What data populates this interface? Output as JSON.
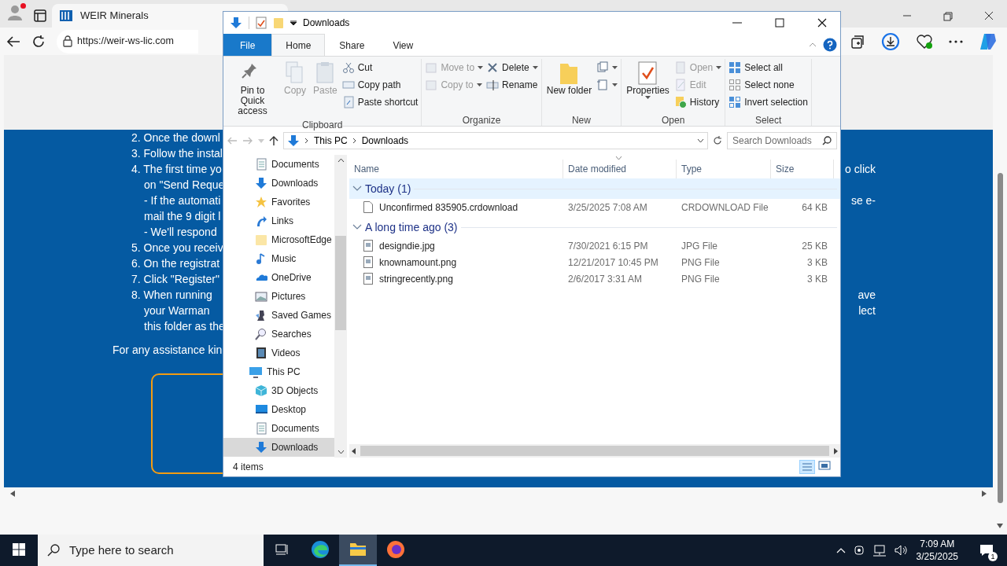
{
  "browser": {
    "tabs": [
      {
        "title": "WEIR Minerals",
        "selected": true
      }
    ],
    "address": "https://weir-ws-lic.com",
    "page": {
      "lines": [
        {
          "kind": "item",
          "text": "2. Once the downl"
        },
        {
          "kind": "item",
          "text": "3. Follow the instal"
        },
        {
          "kind": "item",
          "text": "4. The first time yo",
          "tail": "o click"
        },
        {
          "kind": "continuation",
          "text": "on \"Send Reque"
        },
        {
          "kind": "continuation",
          "text": "- If the automati",
          "tail": "se e-"
        },
        {
          "kind": "continuation",
          "text": "mail the 9 digit l"
        },
        {
          "kind": "continuation",
          "text": "- We'll respond"
        },
        {
          "kind": "item",
          "text": "5. Once you receiv"
        },
        {
          "kind": "item",
          "text": "6. On the registrat"
        },
        {
          "kind": "item",
          "text": "7. Click \"Register\""
        },
        {
          "kind": "item",
          "text": "8. When running",
          "tail": "ave"
        },
        {
          "kind": "continuation",
          "text": "your Warman",
          "tail": "lect"
        },
        {
          "kind": "continuation",
          "text": "this folder as the"
        },
        {
          "kind": "note",
          "text": "For any assistance kin"
        }
      ]
    }
  },
  "explorer": {
    "title": "Downloads",
    "ribbon_tabs": [
      {
        "label": "File",
        "kind": "file",
        "selected": false
      },
      {
        "label": "Home",
        "kind": "tab",
        "selected": true
      },
      {
        "label": "Share",
        "kind": "tab",
        "selected": false
      },
      {
        "label": "View",
        "kind": "tab",
        "selected": false
      }
    ],
    "ribbon_groups": [
      {
        "label": "Clipboard",
        "columns": [
          [
            {
              "kind": "pin",
              "label": "Pin to Quick access",
              "disabled": false
            }
          ],
          [
            {
              "kind": "copy",
              "label": "Copy",
              "disabled": true
            }
          ],
          [
            {
              "kind": "paste",
              "label": "Paste",
              "disabled": true
            }
          ],
          [
            {
              "kind": "cut",
              "label": "Cut",
              "disabled": false
            },
            {
              "kind": "path",
              "label": "Copy path",
              "disabled": false
            },
            {
              "kind": "shortcut",
              "label": "Paste shortcut",
              "disabled": false
            }
          ]
        ]
      },
      {
        "label": "Organize",
        "columns": [
          [
            {
              "kind": "move",
              "label": "Move to",
              "disabled": true
            },
            {
              "kind": "copyto",
              "label": "Copy to",
              "disabled": true
            }
          ],
          [
            {
              "kind": "delete",
              "label": "Delete",
              "disabled": false
            },
            {
              "kind": "rename",
              "label": "Rename",
              "disabled": false
            }
          ]
        ]
      },
      {
        "label": "New",
        "columns": [
          [
            {
              "kind": "folder",
              "label": "New folder",
              "disabled": false
            }
          ],
          [
            {
              "kind": "newitem",
              "disabled": false
            },
            {
              "kind": "easy",
              "disabled": false
            }
          ]
        ]
      },
      {
        "label": "Open",
        "columns": [
          [
            {
              "kind": "properties",
              "label": "Properties",
              "disabled": false
            }
          ],
          [
            {
              "kind": "open",
              "label": "Open",
              "disabled": true
            },
            {
              "kind": "edit",
              "label": "Edit",
              "disabled": true
            },
            {
              "kind": "history",
              "label": "History",
              "disabled": false
            }
          ]
        ]
      },
      {
        "label": "Select",
        "columns": [
          [
            {
              "kind": "selall",
              "label": "Select all",
              "disabled": false
            },
            {
              "kind": "selnone",
              "label": "Select none",
              "disabled": false
            },
            {
              "kind": "invert",
              "label": "Invert selection",
              "disabled": false
            }
          ]
        ]
      }
    ],
    "breadcrumb": [
      "This PC",
      "Downloads"
    ],
    "search_placeholder": "Search Downloads",
    "nav_items": [
      {
        "label": "Documents",
        "kind": "documents",
        "selected": false
      },
      {
        "label": "Downloads",
        "kind": "downloads",
        "selected": false
      },
      {
        "label": "Favorites",
        "kind": "star",
        "selected": false
      },
      {
        "label": "Links",
        "kind": "link",
        "selected": false
      },
      {
        "label": "MicrosoftEdge",
        "kind": "folder",
        "selected": false
      },
      {
        "label": "Music",
        "kind": "music",
        "selected": false
      },
      {
        "label": "OneDrive",
        "kind": "cloud",
        "selected": false
      },
      {
        "label": "Pictures",
        "kind": "pictures",
        "selected": false
      },
      {
        "label": "Saved Games",
        "kind": "games",
        "selected": false
      },
      {
        "label": "Searches",
        "kind": "search",
        "selected": false
      },
      {
        "label": "Videos",
        "kind": "video",
        "selected": false
      },
      {
        "label": "This PC",
        "kind": "pc",
        "selected": false,
        "children": [
          {
            "label": "3D Objects",
            "kind": "cube",
            "selected": false
          },
          {
            "label": "Desktop",
            "kind": "desktop",
            "selected": false
          },
          {
            "label": "Documents",
            "kind": "documents",
            "selected": false
          },
          {
            "label": "Downloads",
            "kind": "downloads",
            "selected": true
          }
        ]
      }
    ],
    "columns": [
      "Name",
      "Date modified",
      "Type",
      "Size"
    ],
    "groups": [
      {
        "label": "Today (1)",
        "rows": [
          {
            "name": "Unconfirmed 835905.crdownload",
            "date": "3/25/2025 7:08 AM",
            "type": "CRDOWNLOAD File",
            "size": "64 KB",
            "kind": "file"
          }
        ]
      },
      {
        "label": "A long time ago (3)",
        "rows": [
          {
            "name": "designdie.jpg",
            "date": "7/30/2021 6:15 PM",
            "type": "JPG File",
            "size": "25 KB",
            "kind": "image"
          },
          {
            "name": "knownamount.png",
            "date": "12/21/2017 10:45 PM",
            "type": "PNG File",
            "size": "3 KB",
            "kind": "image"
          },
          {
            "name": "stringrecently.png",
            "date": "2/6/2017 3:31 AM",
            "type": "PNG File",
            "size": "3 KB",
            "kind": "image"
          }
        ]
      }
    ],
    "status": "4 items"
  },
  "taskbar": {
    "search_placeholder": "Type here to search",
    "apps": [
      {
        "kind": "taskview",
        "active": false
      },
      {
        "kind": "edge",
        "active": false
      },
      {
        "kind": "explorer",
        "active": true
      },
      {
        "kind": "firefox",
        "active": false
      }
    ],
    "time": "7:09 AM",
    "date": "3/25/2025",
    "notifications": "1"
  }
}
